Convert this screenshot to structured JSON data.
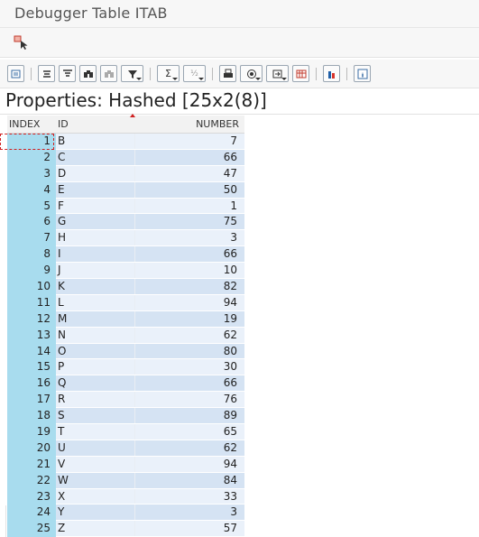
{
  "window": {
    "title": "Debugger Table ITAB"
  },
  "toolbar": {
    "icons": [
      "select-cell-icon",
      "align-center-icon",
      "filter-lines-icon",
      "find-icon",
      "find-next-icon",
      "filter-icon",
      "sum-icon",
      "subtotal-icon",
      "print-icon",
      "export-icon",
      "send-icon",
      "layout-icon",
      "chart-icon",
      "info-icon"
    ]
  },
  "properties": {
    "label": "Properties: Hashed [25x2(8)]"
  },
  "grid": {
    "columns": [
      "INDEX",
      "ID",
      "NUMBER"
    ],
    "rows": [
      {
        "index": "1",
        "id": "B",
        "number": "7"
      },
      {
        "index": "2",
        "id": "C",
        "number": "66"
      },
      {
        "index": "3",
        "id": "D",
        "number": "47"
      },
      {
        "index": "4",
        "id": "E",
        "number": "50"
      },
      {
        "index": "5",
        "id": "F",
        "number": "1"
      },
      {
        "index": "6",
        "id": "G",
        "number": "75"
      },
      {
        "index": "7",
        "id": "H",
        "number": "3"
      },
      {
        "index": "8",
        "id": "I",
        "number": "66"
      },
      {
        "index": "9",
        "id": "J",
        "number": "10"
      },
      {
        "index": "10",
        "id": "K",
        "number": "82"
      },
      {
        "index": "11",
        "id": "L",
        "number": "94"
      },
      {
        "index": "12",
        "id": "M",
        "number": "19"
      },
      {
        "index": "13",
        "id": "N",
        "number": "62"
      },
      {
        "index": "14",
        "id": "O",
        "number": "80"
      },
      {
        "index": "15",
        "id": "P",
        "number": "30"
      },
      {
        "index": "16",
        "id": "Q",
        "number": "66"
      },
      {
        "index": "17",
        "id": "R",
        "number": "76"
      },
      {
        "index": "18",
        "id": "S",
        "number": "89"
      },
      {
        "index": "19",
        "id": "T",
        "number": "65"
      },
      {
        "index": "20",
        "id": "U",
        "number": "62"
      },
      {
        "index": "21",
        "id": "V",
        "number": "94"
      },
      {
        "index": "22",
        "id": "W",
        "number": "84"
      },
      {
        "index": "23",
        "id": "X",
        "number": "33"
      },
      {
        "index": "24",
        "id": "Y",
        "number": "3"
      },
      {
        "index": "25",
        "id": "Z",
        "number": "57"
      }
    ]
  }
}
